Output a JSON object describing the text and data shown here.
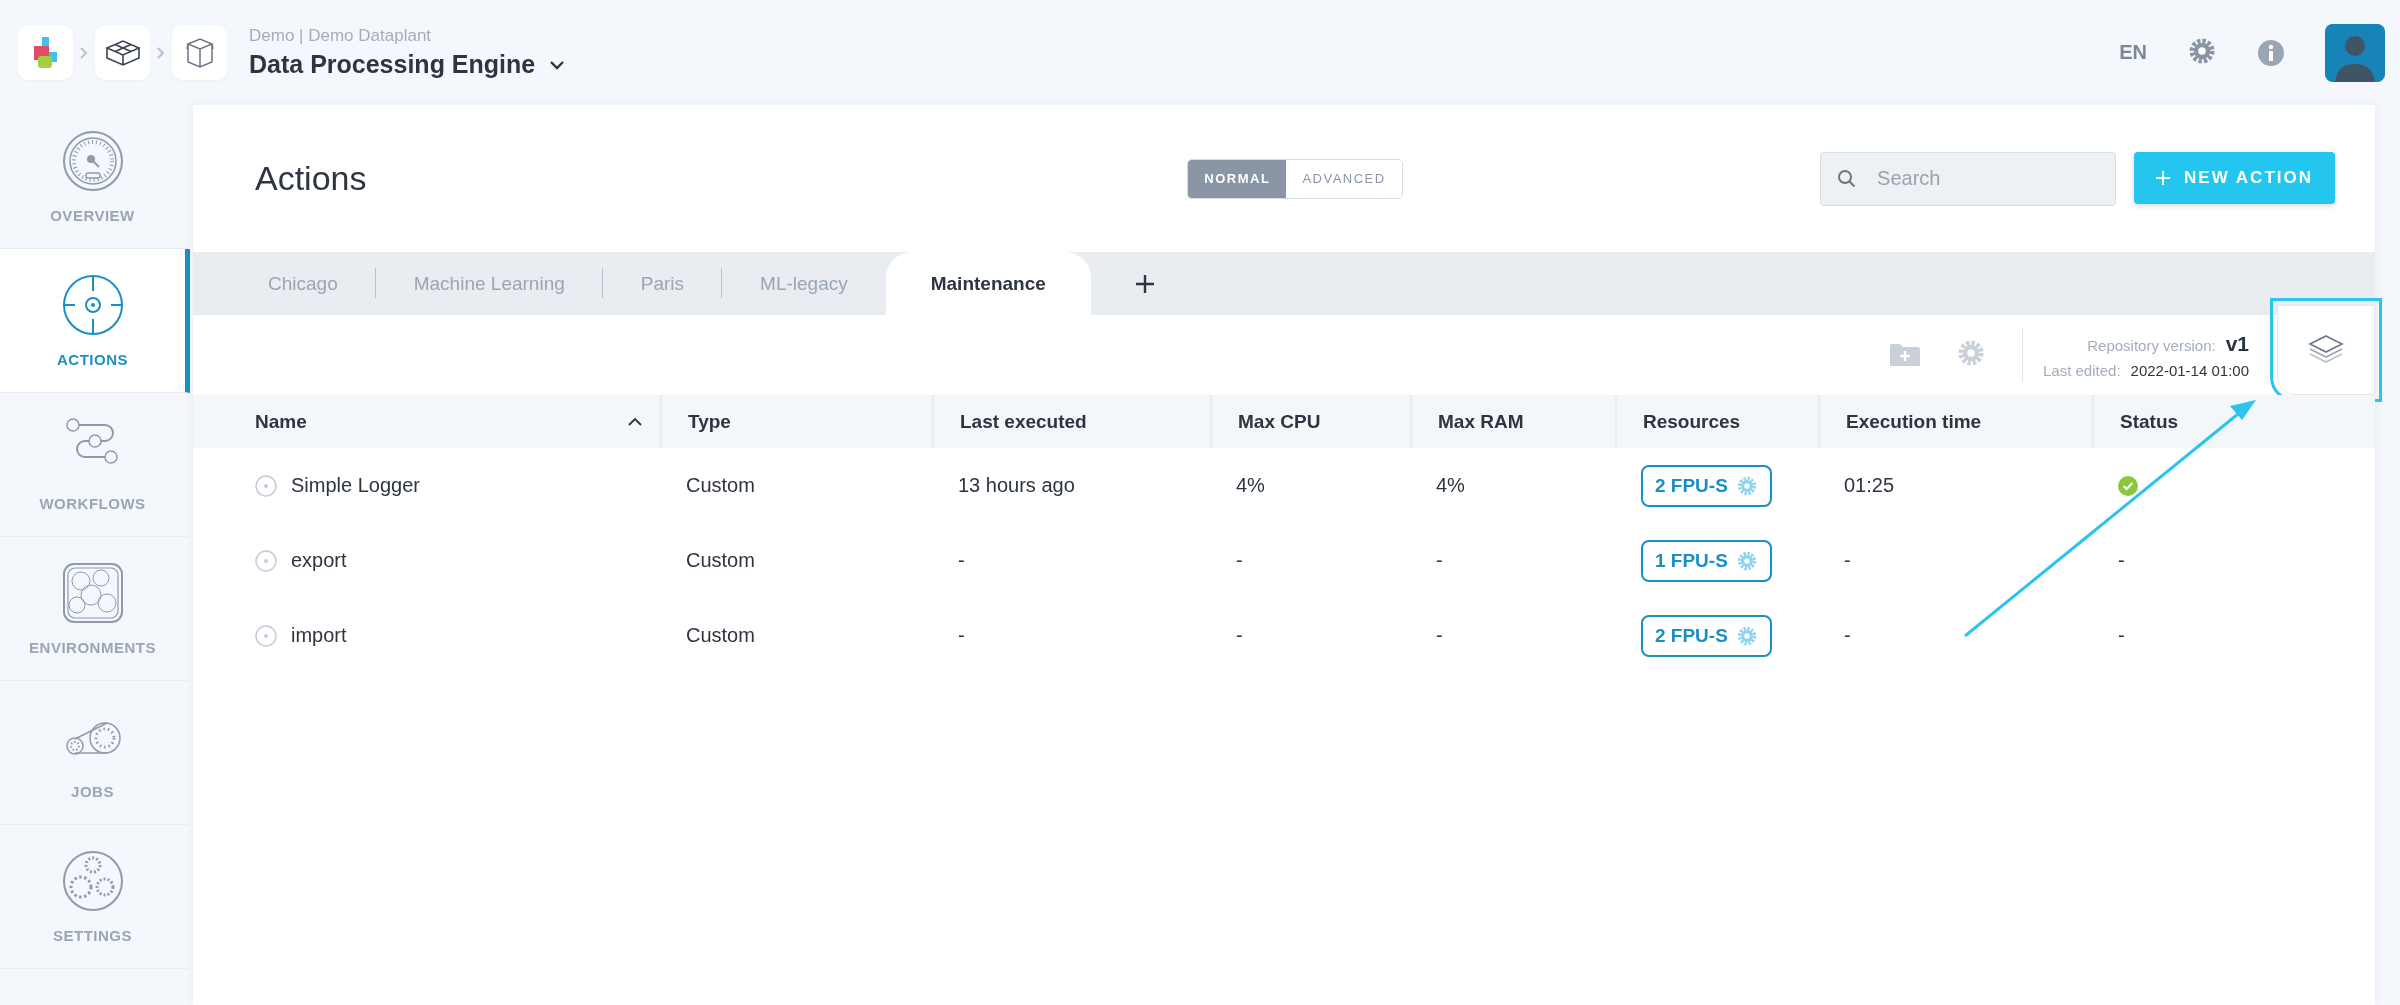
{
  "header": {
    "subtitle": "Demo | Demo Dataplant",
    "title": "Data Processing Engine",
    "language": "EN"
  },
  "sidebar": {
    "items": [
      {
        "label": "OVERVIEW",
        "selected": false
      },
      {
        "label": "ACTIONS",
        "selected": true
      },
      {
        "label": "WORKFLOWS",
        "selected": false
      },
      {
        "label": "ENVIRONMENTS",
        "selected": false
      },
      {
        "label": "JOBS",
        "selected": false
      },
      {
        "label": "SETTINGS",
        "selected": false
      }
    ]
  },
  "page": {
    "title": "Actions",
    "mode_toggle": [
      {
        "label": "NORMAL",
        "selected": true
      },
      {
        "label": "ADVANCED",
        "selected": false
      }
    ],
    "search": {
      "placeholder": "Search"
    },
    "new_button": {
      "label": "NEW ACTION"
    }
  },
  "tabs": [
    {
      "label": "Chicago",
      "selected": false
    },
    {
      "label": "Machine Learning",
      "selected": false
    },
    {
      "label": "Paris",
      "selected": false
    },
    {
      "label": "ML-legacy",
      "selected": false
    },
    {
      "label": "Maintenance",
      "selected": true
    }
  ],
  "toolbar": {
    "version_label": "Repository version:",
    "version": "v1",
    "edited_label": "Last edited:",
    "edited": "2022-01-14 01:00",
    "layers_button": {
      "highlighted": true
    }
  },
  "table": {
    "columns": [
      {
        "label": "Name",
        "sorted": true
      },
      {
        "label": "Type",
        "sorted": false
      },
      {
        "label": "Last executed",
        "sorted": false
      },
      {
        "label": "Max CPU",
        "sorted": false
      },
      {
        "label": "Max RAM",
        "sorted": false
      },
      {
        "label": "Resources",
        "sorted": false
      },
      {
        "label": "Execution time",
        "sorted": false
      },
      {
        "label": "Status",
        "sorted": false
      }
    ],
    "rows": [
      {
        "name": "Simple Logger",
        "type": "Custom",
        "last_executed": "13 hours ago",
        "max_cpu": "4%",
        "max_ram": "4%",
        "resources": "2 FPU-S",
        "execution_time": "01:25",
        "status": {
          "kind": "success"
        }
      },
      {
        "name": "export",
        "type": "Custom",
        "last_executed": "-",
        "max_cpu": "-",
        "max_ram": "-",
        "resources": "1 FPU-S",
        "execution_time": "-",
        "status": {
          "kind": "text",
          "text": "-"
        }
      },
      {
        "name": "import",
        "type": "Custom",
        "last_executed": "-",
        "max_cpu": "-",
        "max_ram": "-",
        "resources": "2 FPU-S",
        "execution_time": "-",
        "status": {
          "kind": "text",
          "text": "-"
        }
      }
    ]
  }
}
